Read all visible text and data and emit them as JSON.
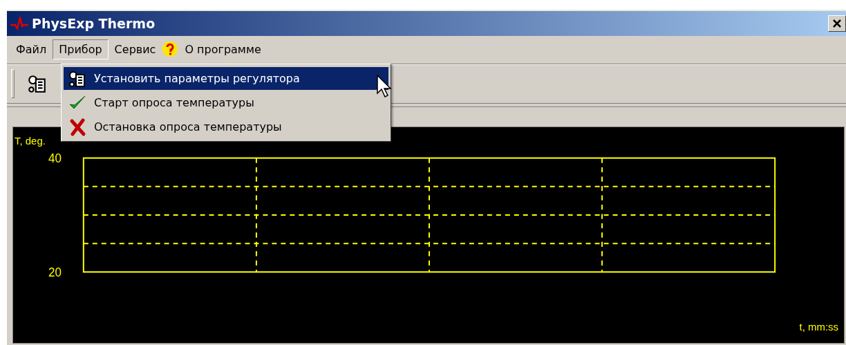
{
  "window": {
    "title": "PhysExp Thermo"
  },
  "menu": [
    {
      "label": "Файл",
      "selected": false,
      "kind": "text"
    },
    {
      "label": "Прибор",
      "selected": true,
      "kind": "text"
    },
    {
      "label": "Сервис",
      "selected": false,
      "kind": "text"
    },
    {
      "label": "О программе",
      "selected": false,
      "kind": "help"
    }
  ],
  "dropdown": [
    {
      "label": "Установить параметры регулятора",
      "selected": true,
      "kind": "settings"
    },
    {
      "label": "Старт опроса температуры",
      "selected": false,
      "kind": "check"
    },
    {
      "label": "Остановка опроса температуры",
      "selected": false,
      "kind": "cross"
    }
  ],
  "chart": {
    "y_label": "T, deg.",
    "y_ticks": [
      "40",
      "20"
    ],
    "x_label": "t, mm:ss"
  }
}
